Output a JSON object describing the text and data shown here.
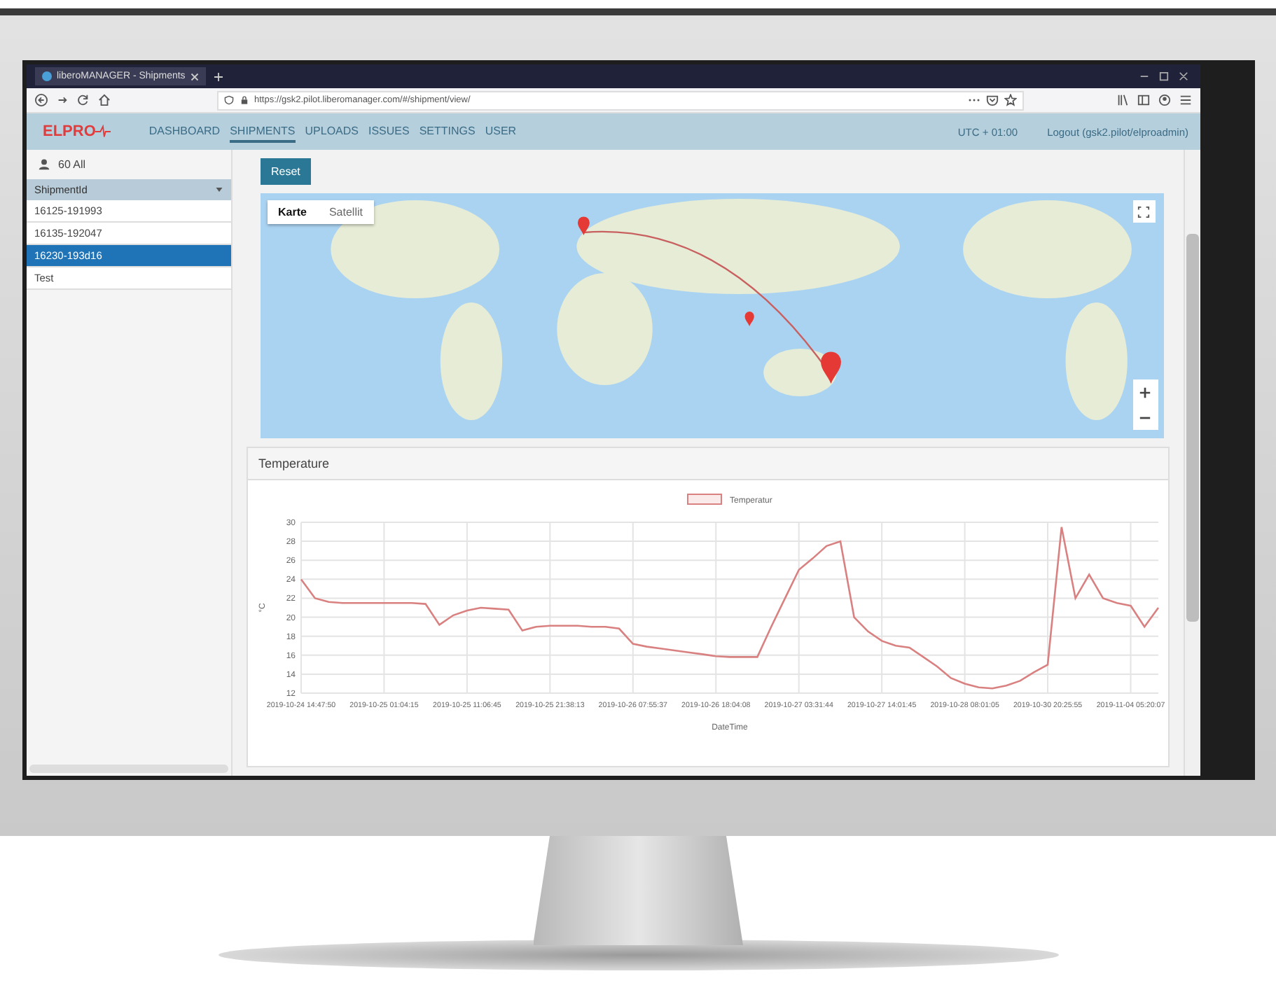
{
  "browser": {
    "tab_title": "liberoMANAGER - Shipments",
    "url": "https://gsk2.pilot.liberomanager.com/#/shipment/view/"
  },
  "nav": {
    "logo": "ELPRO",
    "items": [
      {
        "label": "DASHBOARD",
        "selected": false
      },
      {
        "label": "SHIPMENTS",
        "selected": true
      },
      {
        "label": "UPLOADS",
        "selected": false
      },
      {
        "label": "ISSUES",
        "selected": false
      },
      {
        "label": "SETTINGS",
        "selected": false
      },
      {
        "label": "USER",
        "selected": false
      }
    ],
    "timezone": "UTC + 01:00",
    "logout": "Logout (gsk2.pilot/elproadmin)"
  },
  "sidebar": {
    "filter": "60 All",
    "column": "ShipmentId",
    "rows": [
      {
        "label": "16125-191993",
        "selected": false
      },
      {
        "label": "16135-192047",
        "selected": false
      },
      {
        "label": "16230-193d16",
        "selected": true
      },
      {
        "label": "Test",
        "selected": false
      }
    ]
  },
  "main": {
    "reset": "Reset",
    "map": {
      "tabs": [
        {
          "label": "Karte",
          "selected": true
        },
        {
          "label": "Satellit",
          "selected": false
        }
      ]
    },
    "temperature": {
      "title": "Temperature",
      "chart_data": {
        "type": "line",
        "grid": true,
        "xlabel": "DateTime",
        "ylabel": "°C",
        "ylim": [
          12,
          30
        ],
        "yticks": [
          12,
          14,
          16,
          18,
          20,
          22,
          24,
          26,
          28,
          30
        ],
        "categories": [
          "2019-10-24 14:47:50",
          null,
          null,
          null,
          null,
          null,
          "2019-10-25 01:04:15",
          null,
          null,
          null,
          null,
          null,
          "2019-10-25 11:06:45",
          null,
          null,
          null,
          null,
          null,
          "2019-10-25 21:38:13",
          null,
          null,
          null,
          null,
          null,
          "2019-10-26 07:55:37",
          null,
          null,
          null,
          null,
          null,
          "2019-10-26 18:04:08",
          null,
          null,
          null,
          null,
          null,
          "2019-10-27 03:31:44",
          null,
          null,
          null,
          null,
          null,
          "2019-10-27 14:01:45",
          null,
          null,
          null,
          null,
          null,
          "2019-10-28 08:01:05",
          null,
          null,
          null,
          null,
          null,
          "2019-10-30 20:25:55",
          null,
          null,
          null,
          null,
          null,
          "2019-11-04 05:20:07",
          null,
          null
        ],
        "series": [
          {
            "name": "Temperatur",
            "color": "#d98080",
            "values": [
              24,
              22,
              21.6,
              21.5,
              21.5,
              21.5,
              21.5,
              21.5,
              21.5,
              21.4,
              19.2,
              20.2,
              20.7,
              21,
              20.9,
              20.8,
              18.6,
              19,
              19.1,
              19.1,
              19.1,
              19,
              19,
              18.8,
              17.2,
              16.9,
              16.7,
              16.5,
              16.3,
              16.1,
              15.9,
              15.8,
              15.8,
              15.8,
              19,
              22,
              25,
              26.2,
              27.5,
              28,
              20,
              18.5,
              17.5,
              17,
              16.8,
              15.8,
              14.8,
              13.6,
              13,
              12.6,
              12.5,
              12.8,
              13.3,
              14.2,
              15,
              29.5,
              22,
              24.5,
              22,
              21.5,
              21.2,
              19,
              21
            ]
          }
        ]
      }
    }
  }
}
